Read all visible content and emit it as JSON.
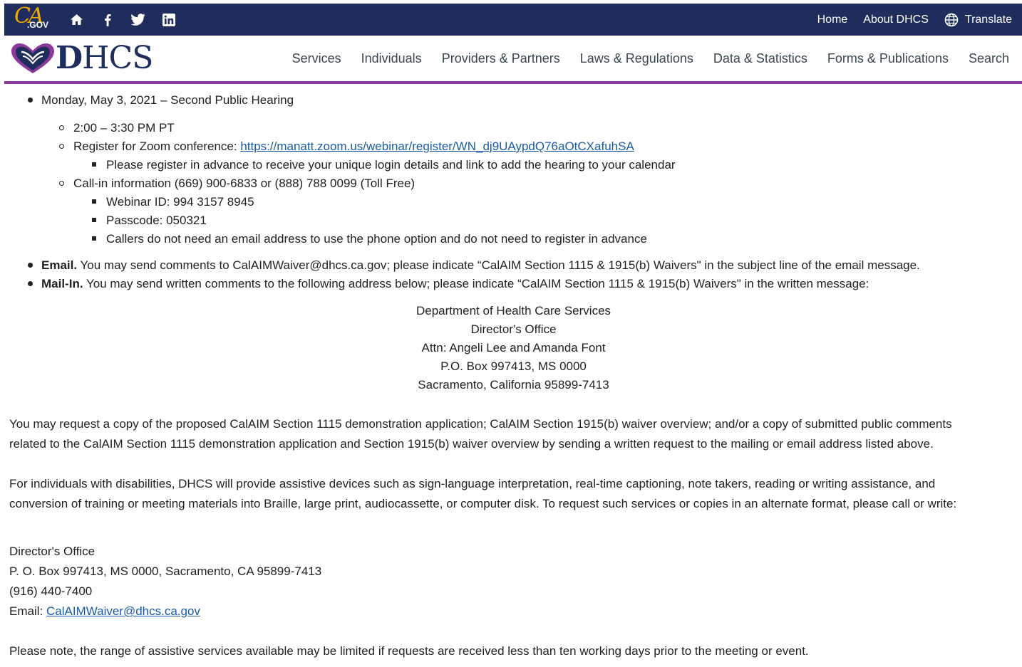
{
  "utility_bar": {
    "logo_text_ca": "CA",
    "logo_text_gov": ".GOV",
    "social_icons": [
      "home-icon",
      "facebook-icon",
      "twitter-icon",
      "linkedin-icon"
    ],
    "links": [
      "Home",
      "About DHCS"
    ],
    "translate_label": "Translate",
    "background_color": "#1f2d5c"
  },
  "header": {
    "logo_text_bold": "D",
    "logo_text_rest": "HCS",
    "nav": [
      "Services",
      "Individuals",
      "Providers & Partners",
      "Laws & Regulations",
      "Data & Statistics",
      "Forms & Publications",
      "Search"
    ],
    "accent_color": "#8b3a9c"
  },
  "hearing": {
    "title": "Monday, May 3, 2021 – Second Public Hearing",
    "time": "2:00 – 3:30 PM PT",
    "register_label": "Register for Zoom conference: ",
    "register_link": "https://manatt.zoom.us/webinar/register/WN_dj9UAypdQ76aOtCXafuhSA",
    "register_note": "Please register in advance to receive your unique login details and link to add the hearing to your calendar",
    "callin_label": "Call-in information (669) 900-6833 or (888) 788 0099 (Toll Free)",
    "webinar_id": "Webinar ID: 994 3157 8945",
    "passcode": "Passcode: 050321",
    "callers_note": "Callers do not need an email address to use the phone option and do not need to register in advance"
  },
  "email_item": {
    "label": "Email.",
    "text": " You may send comments to CalAIMWaiver@dhcs.ca.gov; please indicate “CalAIM Section 1115 & 1915(b) Waivers\" in the subject line of the email message."
  },
  "mail_item": {
    "label": "Mail-In.",
    "text": " You may send written comments to the following address below; please indicate “CalAIM Section 1115 & 1915(b) Waivers\" in the written message:"
  },
  "mail_address": [
    "Department of Health Care Services",
    "Director's Office",
    "Attn: Angeli Lee and Amanda Font",
    "P.O. Box 997413, MS 0000",
    "Sacramento, California 95899-7413"
  ],
  "request_copy": {
    "line1": "You may request a copy of the proposed CalAIM Section 1115 demonstration application; CalAIM Section 1915(b) waiver overview; and/or a copy of submitted public comments",
    "line2": "related to the CalAIM Section 1115 demonstration application and Section 1915(b) waiver overview by sending a written request to the mailing or email address listed above."
  },
  "disabilities": {
    "line1": "For individuals with disabilities, DHCS will provide assistive devices such as sign-language interpretation, real-time captioning, note takers, reading or writing assistance, and",
    "line2": "conversion of training or meeting materials into Braille, large print, audiocassette, or computer disk. To request such services or copies in an alternate format, please call or write:"
  },
  "contact": {
    "office": "Director's Office",
    "address": "P. O. Box 997413, MS 0000, Sacramento, CA 95899-7413",
    "phone": "(916) 440-7400",
    "email_label": "Email: ",
    "email": "CalAIMWaiver@dhcs.ca.gov"
  },
  "note": "Please note, the range of assistive services available may be limited if requests are received less than ten working days prior to the meeting or event."
}
